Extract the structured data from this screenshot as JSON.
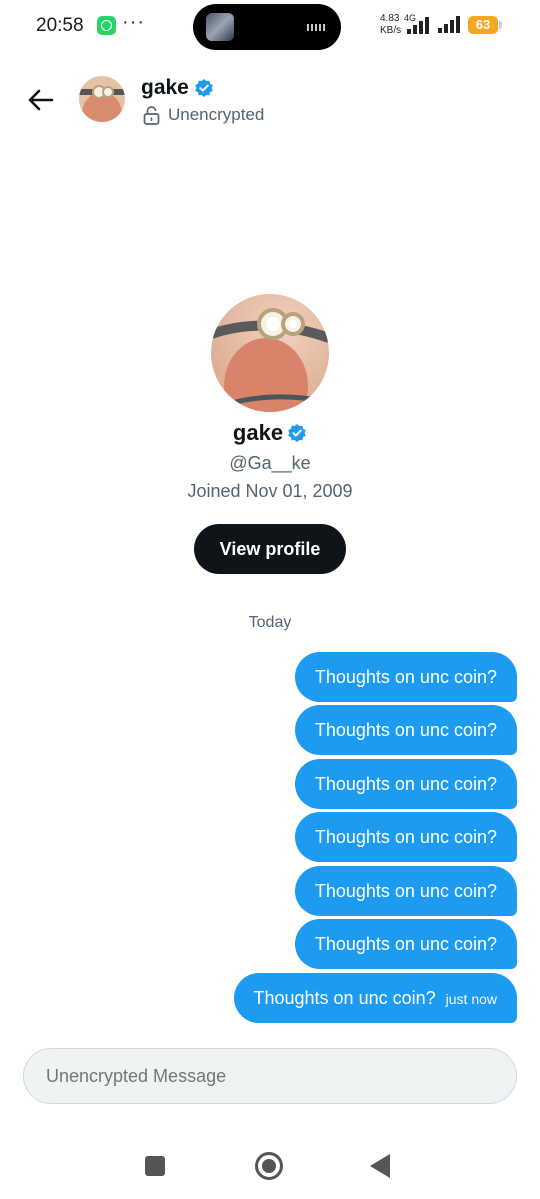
{
  "status_bar": {
    "time": "20:58",
    "net_speed": "4.83",
    "net_unit": "KB/s",
    "network_type": "4G",
    "battery": "63",
    "icons": [
      "whatsapp-icon",
      "more-dots-icon",
      "signal-icon",
      "battery-icon"
    ]
  },
  "header": {
    "name": "gake",
    "subtitle": "Unencrypted"
  },
  "profile": {
    "name": "gake",
    "handle": "@Ga__ke",
    "joined": "Joined Nov 01, 2009",
    "view_profile_label": "View profile"
  },
  "conversation": {
    "date_divider": "Today",
    "messages": [
      {
        "text": "Thoughts on unc coin?"
      },
      {
        "text": "Thoughts on unc coin?"
      },
      {
        "text": "Thoughts on unc coin?"
      },
      {
        "text": "Thoughts on unc coin?"
      },
      {
        "text": "Thoughts on unc coin?"
      },
      {
        "text": "Thoughts on unc coin?"
      },
      {
        "text": "Thoughts on unc coin?",
        "time": "just now"
      }
    ]
  },
  "composer": {
    "placeholder": "Unencrypted Message"
  },
  "colors": {
    "accent": "#1d9bf0",
    "battery": "#f5a623",
    "verified": "#1d9bf0"
  }
}
